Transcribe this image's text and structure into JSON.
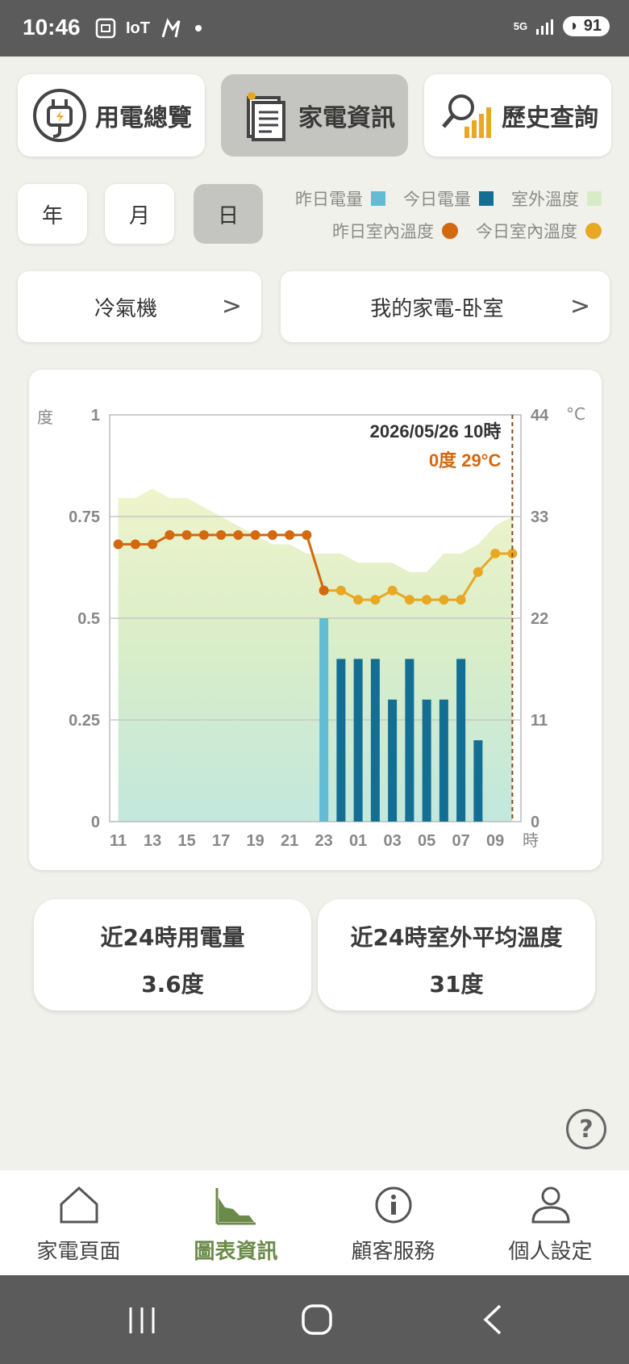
{
  "status": {
    "time": "10:46",
    "iot": "IoT",
    "network": "5G",
    "battery": "91"
  },
  "topnav": [
    {
      "label": "用電總覽",
      "icon": "plug-icon",
      "active": false
    },
    {
      "label": "家電資訊",
      "icon": "document-icon",
      "active": true
    },
    {
      "label": "歷史查詢",
      "icon": "history-chart-icon",
      "active": false
    }
  ],
  "periods": [
    {
      "label": "年",
      "active": false
    },
    {
      "label": "月",
      "active": false
    },
    {
      "label": "日",
      "active": true
    }
  ],
  "legend": {
    "yesterday_power": "昨日電量",
    "today_power": "今日電量",
    "outdoor_temp": "室外溫度",
    "yesterday_indoor": "昨日室內溫度",
    "today_indoor": "今日室內溫度"
  },
  "selectors": {
    "appliance": "冷氣機",
    "location": "我的家電-卧室",
    "chevron": ">"
  },
  "colors": {
    "yesterday_power": "#62bcd4",
    "today_power": "#136e94",
    "outdoor_temp": "#d6ecc6",
    "yesterday_indoor": "#d3680f",
    "today_indoor": "#e8a821",
    "accent": "#6b8a4a"
  },
  "chart_data": {
    "type": "bar",
    "ylabel_left": "度",
    "ylabel_right": "°C",
    "xlabel": "時",
    "ylim_left": [
      0,
      1
    ],
    "ylim_right": [
      0,
      44
    ],
    "yticks_left": [
      "0",
      "0.25",
      "0.5",
      "0.75",
      "1"
    ],
    "yticks_right": [
      "0",
      "11",
      "22",
      "33",
      "44"
    ],
    "xticks": [
      "11",
      "13",
      "15",
      "17",
      "19",
      "21",
      "23",
      "01",
      "03",
      "05",
      "07",
      "09"
    ],
    "hours": [
      "11",
      "12",
      "13",
      "14",
      "15",
      "16",
      "17",
      "18",
      "19",
      "20",
      "21",
      "22",
      "23",
      "00",
      "01",
      "02",
      "03",
      "04",
      "05",
      "06",
      "07",
      "08",
      "09",
      "10"
    ],
    "power": {
      "yesterday": [
        0,
        0,
        0,
        0,
        0,
        0,
        0,
        0,
        0,
        0,
        0,
        0,
        0.5,
        null,
        null,
        null,
        null,
        null,
        null,
        null,
        null,
        null,
        null,
        null
      ],
      "today": [
        null,
        null,
        null,
        null,
        null,
        null,
        null,
        null,
        null,
        null,
        null,
        null,
        null,
        0.4,
        0.4,
        0.4,
        0.3,
        0.4,
        0.3,
        0.3,
        0.4,
        0.2,
        0,
        0
      ]
    },
    "outdoor_temp": [
      35,
      35,
      36,
      35,
      35,
      34,
      33,
      32,
      31,
      30,
      30,
      29,
      29,
      29,
      28,
      28,
      28,
      27,
      27,
      29,
      29,
      30,
      32,
      33
    ],
    "indoor_temp": {
      "yesterday": [
        30,
        30,
        30,
        31,
        31,
        31,
        31,
        31,
        31,
        31,
        31,
        31,
        25,
        null,
        null,
        null,
        null,
        null,
        null,
        null,
        null,
        null,
        null,
        null
      ],
      "today": [
        null,
        null,
        null,
        null,
        null,
        null,
        null,
        null,
        null,
        null,
        null,
        null,
        25,
        25,
        24,
        24,
        25,
        24,
        24,
        24,
        24,
        27,
        29,
        29
      ]
    },
    "grid": true,
    "tooltip": {
      "title": "2026/05/26 10時",
      "value": "0度 29°C"
    }
  },
  "summary": [
    {
      "title": "近24時用電量",
      "value": "3.6度"
    },
    {
      "title": "近24時室外平均溫度",
      "value": "31度"
    }
  ],
  "help": "?",
  "bottomnav": [
    {
      "label": "家電頁面",
      "icon": "home-icon",
      "active": false
    },
    {
      "label": "圖表資訊",
      "icon": "chart-icon",
      "active": true
    },
    {
      "label": "顧客服務",
      "icon": "info-icon",
      "active": false
    },
    {
      "label": "個人設定",
      "icon": "user-icon",
      "active": false
    }
  ]
}
